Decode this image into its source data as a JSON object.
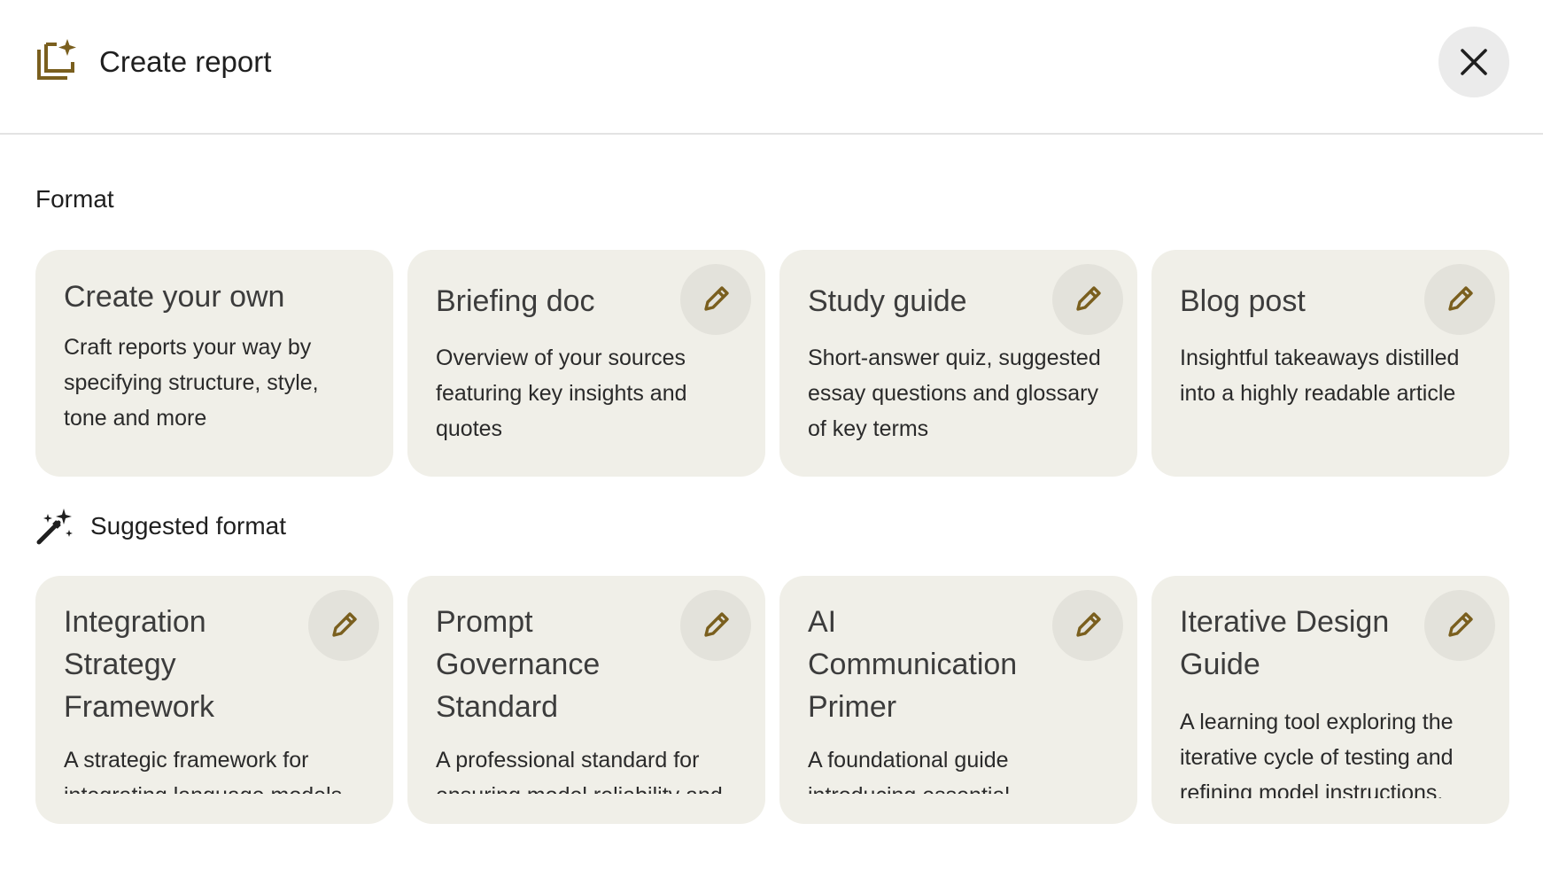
{
  "header": {
    "icon": "report-sparkle-icon",
    "title": "Create report",
    "close_icon": "close-icon"
  },
  "format": {
    "label": "Format",
    "cards": [
      {
        "title": "Create your own",
        "description": "Craft reports your way by specifying structure, style, tone and more",
        "editable": false
      },
      {
        "title": "Briefing doc",
        "description": "Overview of your sources featuring key insights and quotes",
        "editable": true
      },
      {
        "title": "Study guide",
        "description": "Short-answer quiz, suggested essay questions and glossary of key terms",
        "editable": true
      },
      {
        "title": "Blog post",
        "description": "Insightful takeaways distilled into a highly readable article",
        "editable": true
      }
    ]
  },
  "suggested": {
    "icon": "magic-wand-icon",
    "label": "Suggested format",
    "cards": [
      {
        "title": "Integration Strategy Framework",
        "description": "A strategic framework for integrating language models"
      },
      {
        "title": "Prompt Governance Standard",
        "description": "A professional standard for ensuring model reliability and"
      },
      {
        "title": "AI Communication Primer",
        "description": "A foundational guide introducing essential"
      },
      {
        "title": "Iterative Design Guide",
        "description": "A learning tool exploring the iterative cycle of testing and refining model instructions."
      }
    ]
  },
  "colors": {
    "accent": "#7a5f1e",
    "card_bg": "#f0efe8",
    "edit_button_bg": "#e3e2db",
    "close_button_bg": "#ebebeb"
  }
}
